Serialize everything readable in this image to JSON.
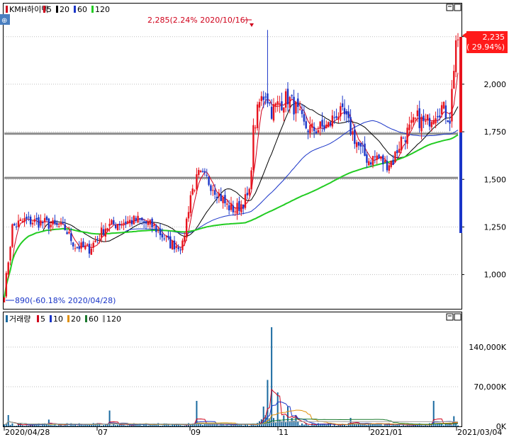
{
  "chart_data": [
    {
      "type": "candlestick",
      "symbol": "KMH하이텍",
      "legend": [
        {
          "label": "KMH하이텍",
          "color": "#d0021b"
        },
        {
          "label": "5",
          "color": "#d0021b"
        },
        {
          "label": "20",
          "color": "#000000"
        },
        {
          "label": "60",
          "color": "#1a35c8"
        },
        {
          "label": "120",
          "color": "#22cc22"
        }
      ],
      "ylim": [
        820,
        2420
      ],
      "y_ticks": [
        1000,
        1250,
        1500,
        1750,
        2000,
        2250
      ],
      "y_tick_labels": [
        "1,000",
        "1,250",
        "1,500",
        "1,750",
        "2,000",
        "2,250"
      ],
      "x_tick_labels": [
        "2020/04/28",
        "07",
        "09",
        "11",
        "2021/01",
        "2021/03/04"
      ],
      "support_lines": [
        1740,
        1508
      ],
      "high_annotation": {
        "text": "2,285(2.24% 2020/10/16)",
        "value": 2285
      },
      "low_annotation": {
        "text": "890(-60.18% 2020/04/28)",
        "value": 890
      },
      "last_price": {
        "label": "2,235",
        "change": "( 29.94%)",
        "color": "#ff1a1a"
      },
      "price_path": [
        [
          0,
          900
        ],
        [
          4,
          1250
        ],
        [
          10,
          1285
        ],
        [
          20,
          1270
        ],
        [
          30,
          1240
        ],
        [
          35,
          1150
        ],
        [
          42,
          1135
        ],
        [
          50,
          1250
        ],
        [
          58,
          1275
        ],
        [
          66,
          1285
        ],
        [
          74,
          1250
        ],
        [
          82,
          1160
        ],
        [
          88,
          1150
        ],
        [
          92,
          1420
        ],
        [
          96,
          1520
        ],
        [
          100,
          1500
        ],
        [
          104,
          1450
        ],
        [
          110,
          1360
        ],
        [
          114,
          1340
        ],
        [
          118,
          1380
        ],
        [
          121,
          1420
        ],
        [
          123,
          1750
        ],
        [
          126,
          1900
        ],
        [
          129,
          1960
        ],
        [
          132,
          1860
        ],
        [
          136,
          1900
        ],
        [
          140,
          1930
        ],
        [
          144,
          1870
        ],
        [
          148,
          1780
        ],
        [
          152,
          1760
        ],
        [
          156,
          1770
        ],
        [
          160,
          1780
        ],
        [
          164,
          1850
        ],
        [
          168,
          1830
        ],
        [
          172,
          1740
        ],
        [
          176,
          1650
        ],
        [
          180,
          1600
        ],
        [
          184,
          1620
        ],
        [
          188,
          1580
        ],
        [
          192,
          1600
        ],
        [
          196,
          1710
        ],
        [
          200,
          1760
        ],
        [
          204,
          1820
        ],
        [
          208,
          1790
        ],
        [
          212,
          1850
        ],
        [
          216,
          1880
        ],
        [
          220,
          1820
        ],
        [
          223,
          2235
        ]
      ],
      "ma_period_order": [
        "5",
        "20",
        "60",
        "120"
      ],
      "ma_colors": {
        "5": "#d0021b",
        "20": "#000000",
        "60": "#1a35c8",
        "120": "#22cc22"
      }
    },
    {
      "type": "bar",
      "legend": [
        {
          "label": "거래량",
          "color": "#1a6aa0"
        },
        {
          "label": "5",
          "color": "#d0021b"
        },
        {
          "label": "10",
          "color": "#1a35c8"
        },
        {
          "label": "20",
          "color": "#e0900a"
        },
        {
          "label": "60",
          "color": "#1b7a2e"
        },
        {
          "label": "120",
          "color": "#a0a0a0"
        }
      ],
      "ylim": [
        0,
        200000
      ],
      "y_ticks": [
        0,
        70000,
        140000
      ],
      "y_tick_labels": [
        "0K",
        "70,000K",
        "140,000K"
      ],
      "volume_spikes": [
        [
          2,
          20000
        ],
        [
          22,
          12000
        ],
        [
          52,
          28000
        ],
        [
          95,
          45000
        ],
        [
          128,
          35000
        ],
        [
          130,
          82000
        ],
        [
          132,
          175000
        ],
        [
          135,
          60000
        ],
        [
          140,
          35000
        ],
        [
          171,
          15000
        ],
        [
          212,
          45000
        ],
        [
          222,
          18000
        ]
      ]
    }
  ]
}
